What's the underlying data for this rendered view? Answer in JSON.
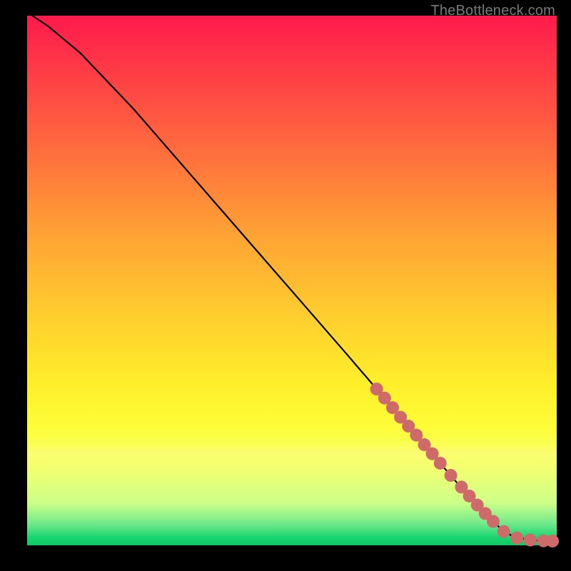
{
  "watermark": "TheBottleneck.com",
  "chart_data": {
    "type": "line",
    "title": "",
    "xlabel": "",
    "ylabel": "",
    "xlim": [
      0,
      100
    ],
    "ylim": [
      0,
      100
    ],
    "grid": false,
    "legend": false,
    "series": [
      {
        "name": "curve",
        "color": "#000000",
        "x": [
          1,
          4,
          10,
          20,
          30,
          40,
          50,
          60,
          66,
          72,
          78,
          84,
          88,
          90,
          92,
          95,
          98,
          99.5
        ],
        "y": [
          100,
          98,
          93,
          82.5,
          71,
          59.5,
          48,
          36.5,
          29.5,
          22.5,
          15.5,
          8.5,
          4.5,
          2.6,
          1.6,
          1.0,
          0.8,
          0.8
        ]
      },
      {
        "name": "highlight-dots",
        "color": "#cf6a6a",
        "x": [
          66,
          67.5,
          69,
          70.5,
          72,
          73.5,
          75,
          76.5,
          78,
          80,
          82,
          83.5,
          85,
          86.5,
          88,
          90,
          92.5,
          95,
          97.5,
          99.2
        ],
        "y": [
          29.5,
          27.8,
          26.0,
          24.2,
          22.5,
          20.8,
          19.0,
          17.3,
          15.5,
          13.2,
          11.0,
          9.3,
          7.6,
          6.0,
          4.5,
          2.6,
          1.4,
          1.0,
          0.85,
          0.8
        ]
      }
    ],
    "colors": {
      "gradient_top": "#ff1a4b",
      "gradient_mid": "#ffd12e",
      "gradient_bottom": "#0ec763",
      "dot": "#cf6a6a",
      "line": "#000000",
      "background": "#000000",
      "watermark": "#7a7a7a"
    }
  }
}
